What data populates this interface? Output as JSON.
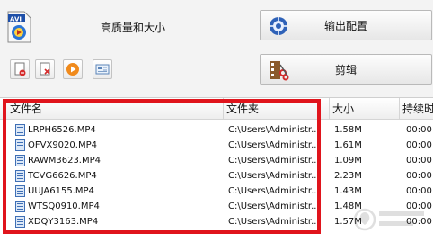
{
  "top": {
    "quality_label": "高质量和大小",
    "output_button": "输出配置",
    "edit_button": "剪辑"
  },
  "icons": {
    "format": "avi-format-icon",
    "output": "globe-settings-icon",
    "edit": "film-scissors-icon",
    "small_buttons": [
      "add-file-icon",
      "delete-file-icon",
      "play-icon",
      "info-icon"
    ]
  },
  "table": {
    "columns": [
      "文件名",
      "文件夹",
      "大小",
      "持续时"
    ],
    "rows": [
      {
        "name": "LRPH6526.MP4",
        "folder": "C:\\Users\\Administr...",
        "size": "1.58M",
        "duration": "00:00:"
      },
      {
        "name": "OFVX9020.MP4",
        "folder": "C:\\Users\\Administr...",
        "size": "1.61M",
        "duration": "00:00:"
      },
      {
        "name": "RAWM3623.MP4",
        "folder": "C:\\Users\\Administr...",
        "size": "1.09M",
        "duration": "00:00:"
      },
      {
        "name": "TCVG6626.MP4",
        "folder": "C:\\Users\\Administr...",
        "size": "2.23M",
        "duration": "00:00:"
      },
      {
        "name": "UUJA6155.MP4",
        "folder": "C:\\Users\\Administr...",
        "size": "1.43M",
        "duration": "00:00:"
      },
      {
        "name": "WTSQ0910.MP4",
        "folder": "C:\\Users\\Administr...",
        "size": "1.48M",
        "duration": "00:00:"
      },
      {
        "name": "XDQY3163.MP4",
        "folder": "C:\\Users\\Administr...",
        "size": "1.57M",
        "duration": "00:00:"
      }
    ]
  },
  "colors": {
    "highlight_frame": "#e0141c"
  }
}
